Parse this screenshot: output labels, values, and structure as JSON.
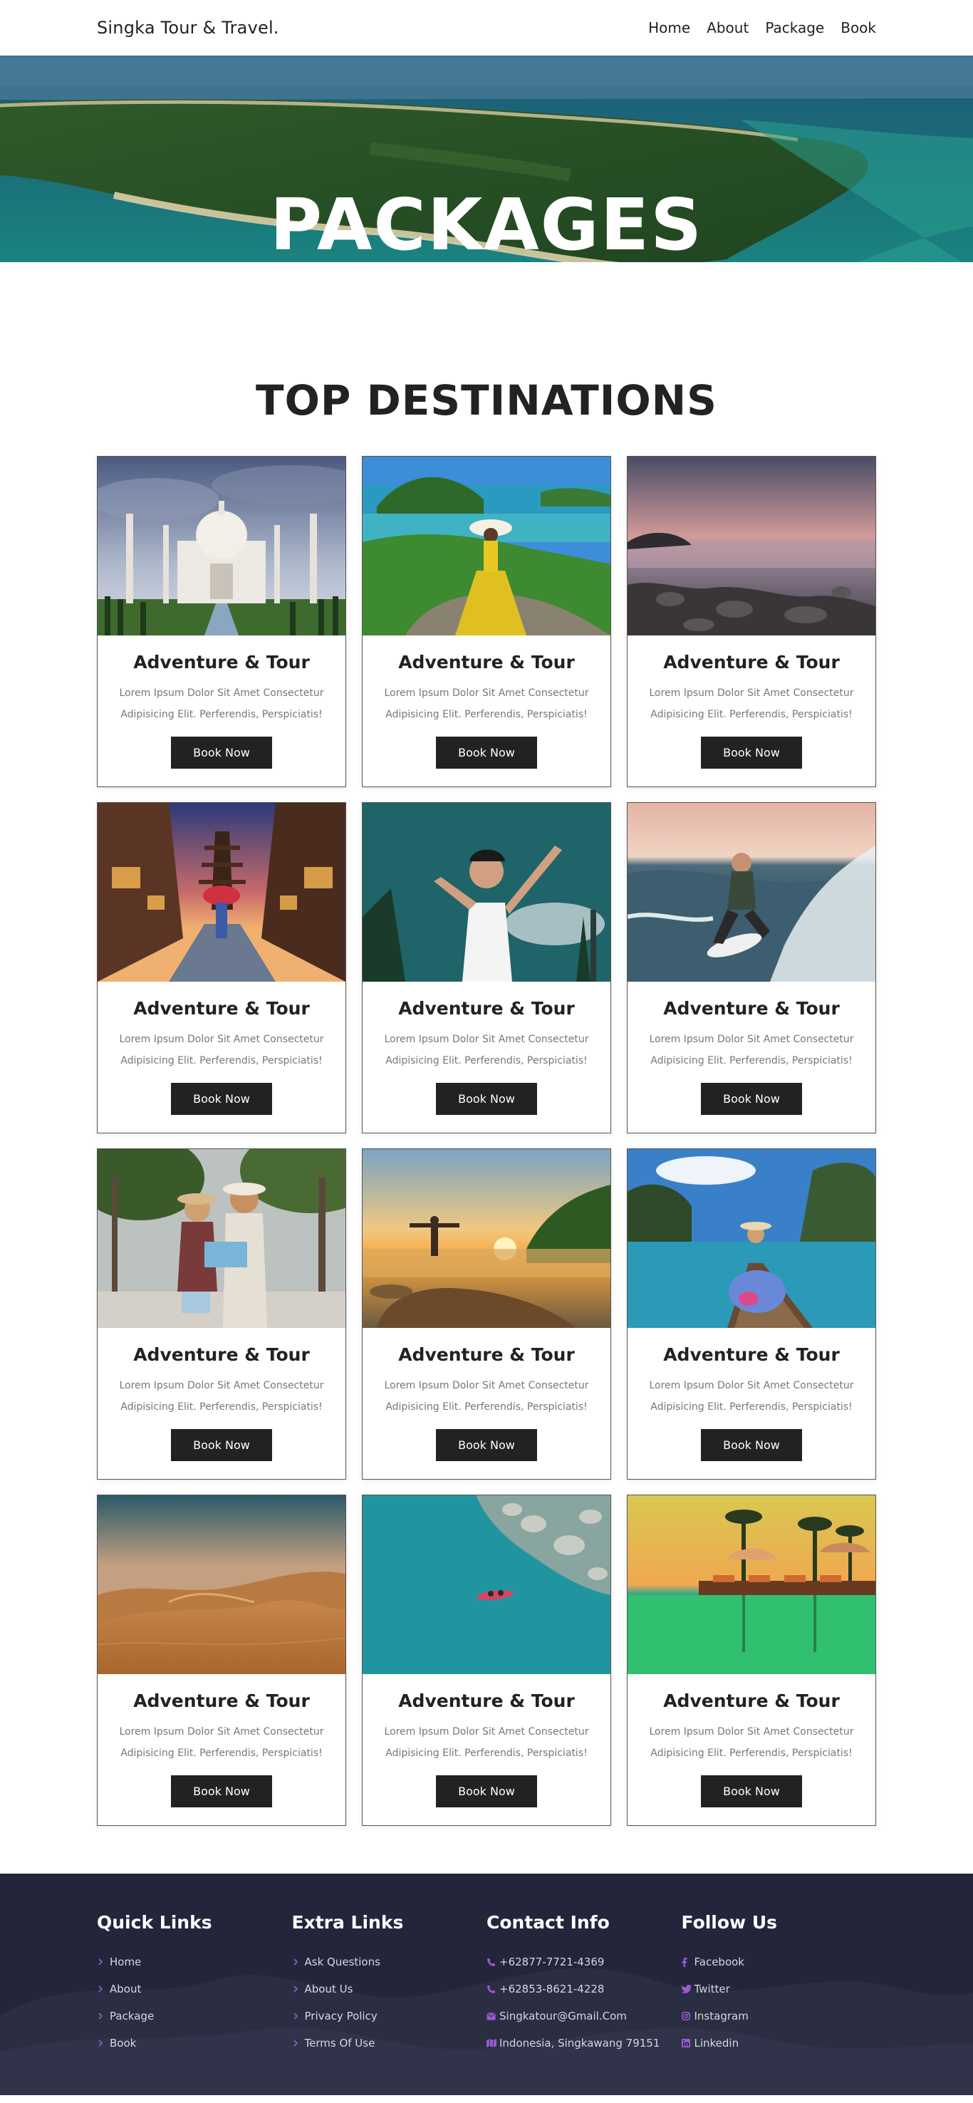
{
  "nav": {
    "logo": "Singka Tour & Travel.",
    "items": [
      {
        "label": "Home"
      },
      {
        "label": "About"
      },
      {
        "label": "Package"
      },
      {
        "label": "Book"
      }
    ]
  },
  "hero": {
    "title": "PACKAGES"
  },
  "destinations": {
    "title": "TOP DESTINATIONS",
    "cards": [
      {
        "title": "Adventure & Tour",
        "text": "Lorem Ipsum Dolor Sit Amet Consectetur Adipisicing Elit. Perferendis, Perspiciatis!",
        "button": "Book Now"
      },
      {
        "title": "Adventure & Tour",
        "text": "Lorem Ipsum Dolor Sit Amet Consectetur Adipisicing Elit. Perferendis, Perspiciatis!",
        "button": "Book Now"
      },
      {
        "title": "Adventure & Tour",
        "text": "Lorem Ipsum Dolor Sit Amet Consectetur Adipisicing Elit. Perferendis, Perspiciatis!",
        "button": "Book Now"
      },
      {
        "title": "Adventure & Tour",
        "text": "Lorem Ipsum Dolor Sit Amet Consectetur Adipisicing Elit. Perferendis, Perspiciatis!",
        "button": "Book Now"
      },
      {
        "title": "Adventure & Tour",
        "text": "Lorem Ipsum Dolor Sit Amet Consectetur Adipisicing Elit. Perferendis, Perspiciatis!",
        "button": "Book Now"
      },
      {
        "title": "Adventure & Tour",
        "text": "Lorem Ipsum Dolor Sit Amet Consectetur Adipisicing Elit. Perferendis, Perspiciatis!",
        "button": "Book Now"
      },
      {
        "title": "Adventure & Tour",
        "text": "Lorem Ipsum Dolor Sit Amet Consectetur Adipisicing Elit. Perferendis, Perspiciatis!",
        "button": "Book Now"
      },
      {
        "title": "Adventure & Tour",
        "text": "Lorem Ipsum Dolor Sit Amet Consectetur Adipisicing Elit. Perferendis, Perspiciatis!",
        "button": "Book Now"
      },
      {
        "title": "Adventure & Tour",
        "text": "Lorem Ipsum Dolor Sit Amet Consectetur Adipisicing Elit. Perferendis, Perspiciatis!",
        "button": "Book Now"
      },
      {
        "title": "Adventure & Tour",
        "text": "Lorem Ipsum Dolor Sit Amet Consectetur Adipisicing Elit. Perferendis, Perspiciatis!",
        "button": "Book Now"
      },
      {
        "title": "Adventure & Tour",
        "text": "Lorem Ipsum Dolor Sit Amet Consectetur Adipisicing Elit. Perferendis, Perspiciatis!",
        "button": "Book Now"
      },
      {
        "title": "Adventure & Tour",
        "text": "Lorem Ipsum Dolor Sit Amet Consectetur Adipisicing Elit. Perferendis, Perspiciatis!",
        "button": "Book Now"
      }
    ]
  },
  "footer": {
    "quick_links": {
      "title": "Quick Links",
      "items": [
        {
          "label": "Home",
          "icon": "chevron-right-icon"
        },
        {
          "label": "About",
          "icon": "chevron-right-icon"
        },
        {
          "label": "Package",
          "icon": "chevron-right-icon"
        },
        {
          "label": "Book",
          "icon": "chevron-right-icon"
        }
      ]
    },
    "extra_links": {
      "title": "Extra Links",
      "items": [
        {
          "label": "Ask Questions",
          "icon": "chevron-right-icon"
        },
        {
          "label": "About Us",
          "icon": "chevron-right-icon"
        },
        {
          "label": "Privacy Policy",
          "icon": "chevron-right-icon"
        },
        {
          "label": "Terms Of Use",
          "icon": "chevron-right-icon"
        }
      ]
    },
    "contact": {
      "title": "Contact Info",
      "items": [
        {
          "label": "+62877-7721-4369",
          "icon": "phone-icon"
        },
        {
          "label": "+62853-8621-4228",
          "icon": "phone-icon"
        },
        {
          "label": "Singkatour@Gmail.Com",
          "icon": "envelope-icon"
        },
        {
          "label": "Indonesia, Singkawang 79151",
          "icon": "map-icon"
        }
      ]
    },
    "follow": {
      "title": "Follow Us",
      "items": [
        {
          "label": "Facebook",
          "icon": "facebook-icon"
        },
        {
          "label": "Twitter",
          "icon": "twitter-icon"
        },
        {
          "label": "Instagram",
          "icon": "instagram-icon"
        },
        {
          "label": "Linkedin",
          "icon": "linkedin-icon"
        }
      ]
    }
  },
  "colors": {
    "dark": "#222222",
    "footer_bg": "#23263a",
    "accent_icon": "#9b59d0"
  }
}
